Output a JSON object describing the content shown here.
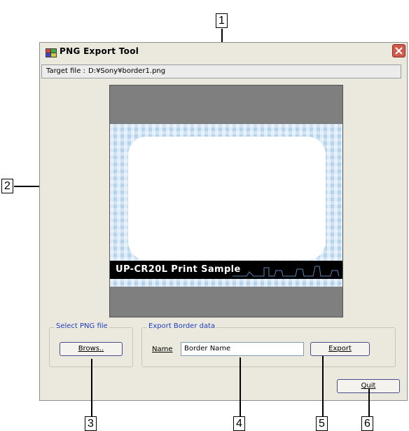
{
  "window": {
    "title": "PNG Export Tool"
  },
  "target": {
    "label": "Target file :",
    "path": "D:¥Sony¥border1.png"
  },
  "preview": {
    "band_text": "UP-CR20L Print Sample"
  },
  "select_group": {
    "title": "Select PNG file",
    "browse_label": "Brows.."
  },
  "export_group": {
    "title": "Export Border data",
    "name_label": "Name",
    "name_value": "Border Name",
    "export_label": "Export"
  },
  "quit_label": "Quit",
  "callouts": [
    "1",
    "2",
    "3",
    "4",
    "5",
    "6"
  ],
  "icons": {
    "app": "png-app-icon",
    "close": "close-icon"
  },
  "colors": {
    "window_bg": "#ebe9dd",
    "group_title": "#1f3fbf",
    "close_button": "#d1584a",
    "preview_bg": "#7f7f7f"
  }
}
